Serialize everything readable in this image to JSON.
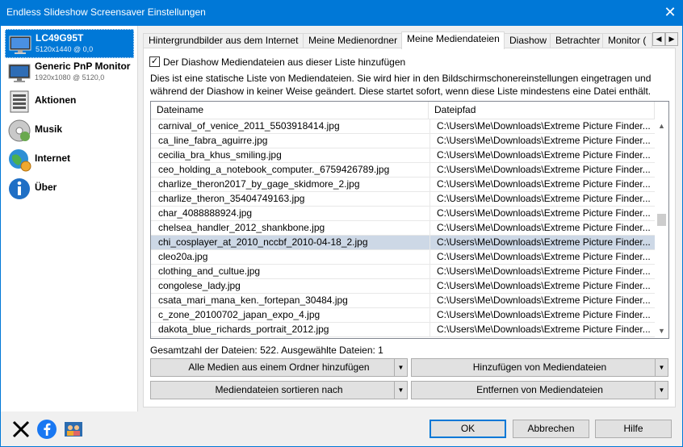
{
  "window": {
    "title": "Endless Slideshow Screensaver Einstellungen",
    "close_glyph": "✕"
  },
  "sidebar": {
    "items": [
      {
        "label": "LC49G95T",
        "sub": "5120x1440 @ 0,0",
        "icon": "monitor-icon",
        "selected": true
      },
      {
        "label": "Generic PnP Monitor",
        "sub": "1920x1080 @ 5120,0",
        "icon": "monitor-icon",
        "selected": false
      },
      {
        "label": "Aktionen",
        "sub": "",
        "icon": "actions-list-icon",
        "selected": false
      },
      {
        "label": "Musik",
        "sub": "",
        "icon": "music-cd-icon",
        "selected": false
      },
      {
        "label": "Internet",
        "sub": "",
        "icon": "internet-globe-icon",
        "selected": false
      },
      {
        "label": "Über",
        "sub": "",
        "icon": "info-icon",
        "selected": false
      }
    ]
  },
  "tabs": [
    {
      "label": "Hintergrundbilder aus dem Internet",
      "active": false
    },
    {
      "label": "Meine Medienordner",
      "active": false
    },
    {
      "label": "Meine Mediendateien",
      "active": true
    },
    {
      "label": "Diashow",
      "active": false
    },
    {
      "label": "Betrachter",
      "active": false
    },
    {
      "label": "Monitor (",
      "active": false
    }
  ],
  "tab_scroll": {
    "left": "◀",
    "right": "▶"
  },
  "panel": {
    "checkbox_label": "Der Diashow Mediendateien aus dieser Liste hinzufügen",
    "checkbox_checked": true,
    "checkbox_mark": "✓",
    "description": "Dies ist eine statische Liste von Mediendateien. Sie wird hier in den Bildschirmschonereinstellungen eingetragen und während der Diashow in keiner Weise geändert. Diese startet sofort, wenn diese Liste mindestens eine Datei enthält.",
    "columns": {
      "name": "Dateiname",
      "path": "Dateipfad"
    },
    "rows": [
      {
        "name": "carnival_of_venice_2011_5503918414.jpg",
        "path": "C:\\Users\\Me\\Downloads\\Extreme Picture Finder...",
        "selected": false
      },
      {
        "name": "ca_line_fabra_aguirre.jpg",
        "path": "C:\\Users\\Me\\Downloads\\Extreme Picture Finder...",
        "selected": false
      },
      {
        "name": "cecilia_bra_khus_smiling.jpg",
        "path": "C:\\Users\\Me\\Downloads\\Extreme Picture Finder...",
        "selected": false
      },
      {
        "name": "ceo_holding_a_notebook_computer._6759426789.jpg",
        "path": "C:\\Users\\Me\\Downloads\\Extreme Picture Finder...",
        "selected": false
      },
      {
        "name": "charlize_theron2017_by_gage_skidmore_2.jpg",
        "path": "C:\\Users\\Me\\Downloads\\Extreme Picture Finder...",
        "selected": false
      },
      {
        "name": "charlize_theron_35404749163.jpg",
        "path": "C:\\Users\\Me\\Downloads\\Extreme Picture Finder...",
        "selected": false
      },
      {
        "name": "char_4088888924.jpg",
        "path": "C:\\Users\\Me\\Downloads\\Extreme Picture Finder...",
        "selected": false
      },
      {
        "name": "chelsea_handler_2012_shankbone.jpg",
        "path": "C:\\Users\\Me\\Downloads\\Extreme Picture Finder...",
        "selected": false
      },
      {
        "name": "chi_cosplayer_at_2010_nccbf_2010-04-18_2.jpg",
        "path": "C:\\Users\\Me\\Downloads\\Extreme Picture Finder...",
        "selected": true
      },
      {
        "name": "cleo20a.jpg",
        "path": "C:\\Users\\Me\\Downloads\\Extreme Picture Finder...",
        "selected": false
      },
      {
        "name": "clothing_and_cultue.jpg",
        "path": "C:\\Users\\Me\\Downloads\\Extreme Picture Finder...",
        "selected": false
      },
      {
        "name": "congolese_lady.jpg",
        "path": "C:\\Users\\Me\\Downloads\\Extreme Picture Finder...",
        "selected": false
      },
      {
        "name": "csata_mari_mana_ken._fortepan_30484.jpg",
        "path": "C:\\Users\\Me\\Downloads\\Extreme Picture Finder...",
        "selected": false
      },
      {
        "name": "c_zone_20100702_japan_expo_4.jpg",
        "path": "C:\\Users\\Me\\Downloads\\Extreme Picture Finder...",
        "selected": false
      },
      {
        "name": "dakota_blue_richards_portrait_2012.jpg",
        "path": "C:\\Users\\Me\\Downloads\\Extreme Picture Finder...",
        "selected": false
      }
    ],
    "scroll": {
      "up": "▲",
      "down": "▼",
      "position": 0.45
    },
    "status": "Gesamtzahl der Dateien: 522. Ausgewählte Dateien: 1",
    "buttons": {
      "add_folder": "Alle Medien aus einem Ordner hinzufügen",
      "add_files": "Hinzufügen von Mediendateien",
      "sort": "Mediendateien sortieren nach",
      "remove": "Entfernen von Mediendateien",
      "drop_glyph": "▼"
    }
  },
  "footer": {
    "social": [
      "x-icon",
      "facebook-icon",
      "community-icon"
    ],
    "ok": "OK",
    "cancel": "Abbrechen",
    "help": "Hilfe"
  },
  "colors": {
    "accent": "#0078d7",
    "selected_row": "#cdd8e6"
  }
}
